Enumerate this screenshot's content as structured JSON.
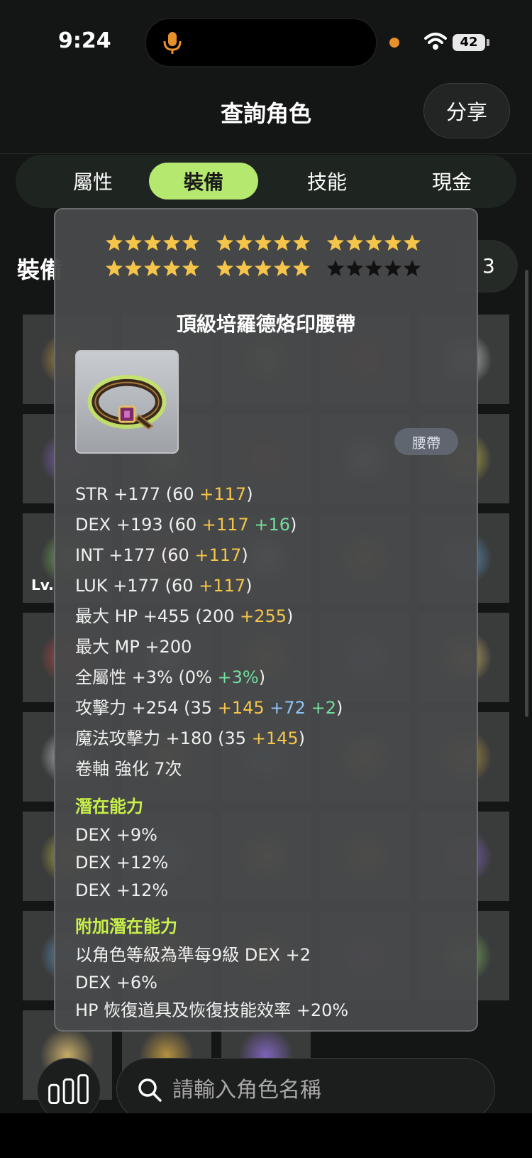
{
  "status_bar": {
    "time": "9:24",
    "battery": "42"
  },
  "header": {
    "title": "查詢角色",
    "share_label": "分享"
  },
  "tabs": [
    {
      "label": "屬性",
      "active": false
    },
    {
      "label": "裝備",
      "active": true
    },
    {
      "label": "技能",
      "active": false
    },
    {
      "label": "現金",
      "active": false
    }
  ],
  "background": {
    "section_label": "裝備",
    "pill_text": "3",
    "lv_text": "Lv."
  },
  "tooltip": {
    "stars": {
      "total": 30,
      "filled": 25,
      "filled_color": "#f5c54a",
      "empty_color": "#111111"
    },
    "item_name": "頂級培羅德烙印腰帶",
    "item_type": "腰帶",
    "stats": [
      {
        "parts": [
          {
            "text": "STR +177 (60 ",
            "c": ""
          },
          {
            "text": "+117",
            "c": "yel"
          },
          {
            "text": ")",
            "c": ""
          }
        ]
      },
      {
        "parts": [
          {
            "text": "DEX +193 (60 ",
            "c": ""
          },
          {
            "text": "+117",
            "c": "yel"
          },
          {
            "text": " ",
            "c": ""
          },
          {
            "text": "+16",
            "c": "grn"
          },
          {
            "text": ")",
            "c": ""
          }
        ]
      },
      {
        "parts": [
          {
            "text": "INT +177 (60 ",
            "c": ""
          },
          {
            "text": "+117",
            "c": "yel"
          },
          {
            "text": ")",
            "c": ""
          }
        ]
      },
      {
        "parts": [
          {
            "text": "LUK +177 (60 ",
            "c": ""
          },
          {
            "text": "+117",
            "c": "yel"
          },
          {
            "text": ")",
            "c": ""
          }
        ]
      },
      {
        "parts": [
          {
            "text": "最大 HP +455 (200 ",
            "c": ""
          },
          {
            "text": "+255",
            "c": "yel"
          },
          {
            "text": ")",
            "c": ""
          }
        ]
      },
      {
        "parts": [
          {
            "text": "最大 MP +200",
            "c": ""
          }
        ]
      },
      {
        "parts": [
          {
            "text": "全屬性 +3% (0% ",
            "c": ""
          },
          {
            "text": "+3%",
            "c": "grn"
          },
          {
            "text": ")",
            "c": ""
          }
        ]
      },
      {
        "parts": [
          {
            "text": "攻擊力 +254  (35 ",
            "c": ""
          },
          {
            "text": "+145",
            "c": "yel"
          },
          {
            "text": " ",
            "c": ""
          },
          {
            "text": "+72",
            "c": "blu"
          },
          {
            "text": " ",
            "c": ""
          },
          {
            "text": "+2",
            "c": "grn"
          },
          {
            "text": ")",
            "c": ""
          }
        ]
      },
      {
        "parts": [
          {
            "text": "魔法攻擊力 +180  (35 ",
            "c": ""
          },
          {
            "text": "+145",
            "c": "yel"
          },
          {
            "text": ")",
            "c": ""
          }
        ]
      },
      {
        "parts": [
          {
            "text": "卷軸 強化 7次",
            "c": ""
          }
        ]
      }
    ],
    "potential_title": "潛在能力",
    "potential": [
      "DEX +9%",
      "DEX +12%",
      "DEX +12%"
    ],
    "additional_title": "附加潛在能力",
    "additional": [
      "以角色等級為準每9級 DEX +2",
      "DEX +6%",
      "HP 恢復道具及恢復技能效率 +20%"
    ]
  },
  "search": {
    "placeholder": "請輸入角色名稱"
  },
  "icons": {
    "mic": "microphone-icon",
    "wifi": "wifi-icon",
    "search": "search-icon",
    "stats": "bar-chart-icon",
    "item": "belt-icon"
  },
  "colors": {
    "accent": "#b4e86e",
    "potential_title": "#c8ef4c",
    "star_gold": "#f5c54a"
  }
}
